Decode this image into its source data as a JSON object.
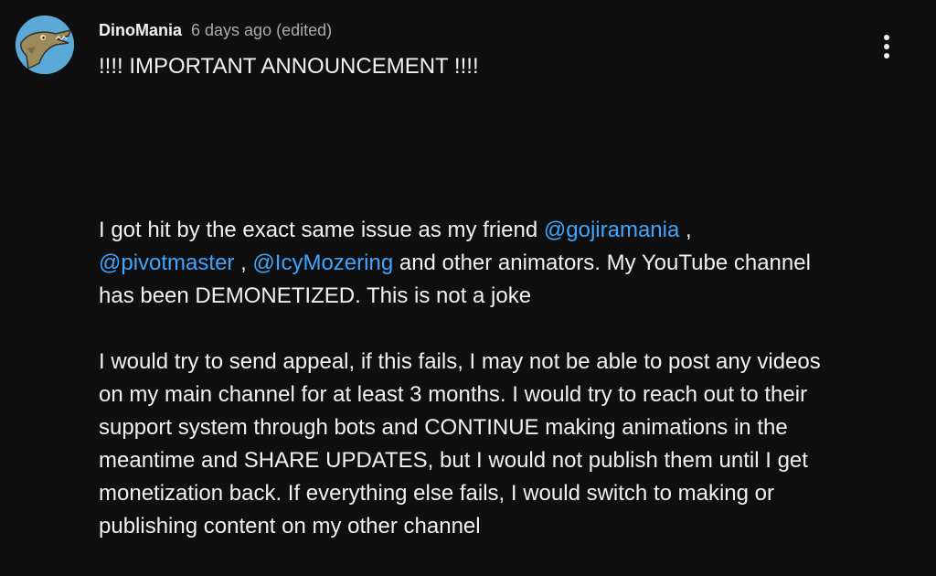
{
  "comment": {
    "author": "DinoMania",
    "time": "6 days ago (edited)",
    "avatar_icon": "dinosaur-avatar-icon",
    "menu_icon": "more-vertical-icon",
    "announcement": "!!!! IMPORTANT ANNOUNCEMENT !!!!",
    "p1_start": "I got hit by the exact same issue as my friend ",
    "mention1": "@gojiramania",
    "sep1": " ,",
    "mention2": "@pivotmaster",
    "sep2": " , ",
    "mention3": "@IcyMozering",
    "p1_end": " and other animators. My YouTube channel has been DEMONETIZED. This is not a joke",
    "p2": "I would try to send appeal, if this fails, I may not be able to post any videos on my main channel for at least 3 months. I would try to reach out to their support system through bots and CONTINUE making animations in the meantime and SHARE UPDATES, but I would not publish them until I get monetization back. If everything else fails, I would switch to making or publishing content on my other channel"
  },
  "colors": {
    "background": "#0f0f0f",
    "text": "#f1f1f1",
    "secondary_text": "#aaaaaa",
    "mention": "#3ea6ff",
    "avatar_bg": "#5aa9d6"
  }
}
